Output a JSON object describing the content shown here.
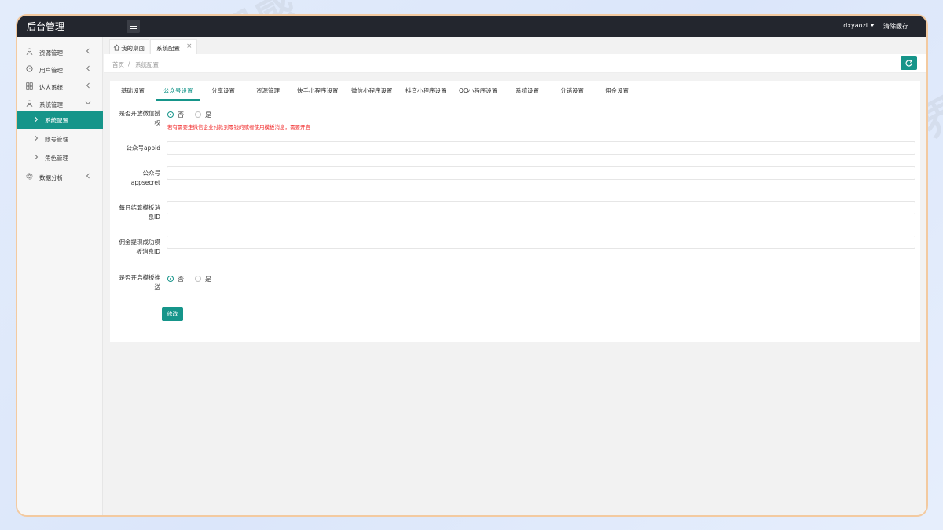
{
  "app": {
    "title": "后台管理"
  },
  "topbar": {
    "username": "dxyaozi",
    "clear_cache": "清除缓存"
  },
  "sidebar": {
    "items": [
      {
        "label": "资源管理",
        "icon": "user-icon"
      },
      {
        "label": "用户管理",
        "icon": "gauge-icon"
      },
      {
        "label": "达人系统",
        "icon": "grid-icon"
      },
      {
        "label": "系统管理",
        "icon": "user-icon"
      }
    ],
    "sub_items": [
      {
        "label": "系统配置",
        "active": true
      },
      {
        "label": "账号管理",
        "active": false
      },
      {
        "label": "角色管理",
        "active": false
      }
    ],
    "last_item": {
      "label": "数据分析",
      "icon": "gear-icon"
    }
  },
  "page_tabs": [
    {
      "label": "我的桌面",
      "icon": "home-icon"
    },
    {
      "label": "系统配置",
      "close": "×"
    }
  ],
  "breadcrumb": {
    "home": "首页",
    "separator": "/",
    "current": "系统配置"
  },
  "config_tabs": [
    "基础设置",
    "公众号设置",
    "分享设置",
    "资源管理",
    "快手小程序设置",
    "微信小程序设置",
    "抖音小程序设置",
    "QQ小程序设置",
    "系统设置",
    "分销设置",
    "佣金设置"
  ],
  "active_config_tab": "公众号设置",
  "form": {
    "auth_label": "是否开放微信授权",
    "radio_no": "否",
    "radio_yes": "是",
    "auth_tip": "若有需要走微信企业付款到零钱的或者使用模板消息，需要开启",
    "appid_label": "公众号appid",
    "appsecret_label": "公众号appsecret",
    "daily_label": "每日结算模板消息ID",
    "commission_label": "佣金提现成功模板消息ID",
    "push_label": "是否开启模板推送",
    "submit": "修改"
  },
  "watermark": "编界感",
  "colors": {
    "accent": "#16958a",
    "topbar": "#23262e",
    "warning": "#f12a2a",
    "frame_border": "#f3caa0"
  }
}
